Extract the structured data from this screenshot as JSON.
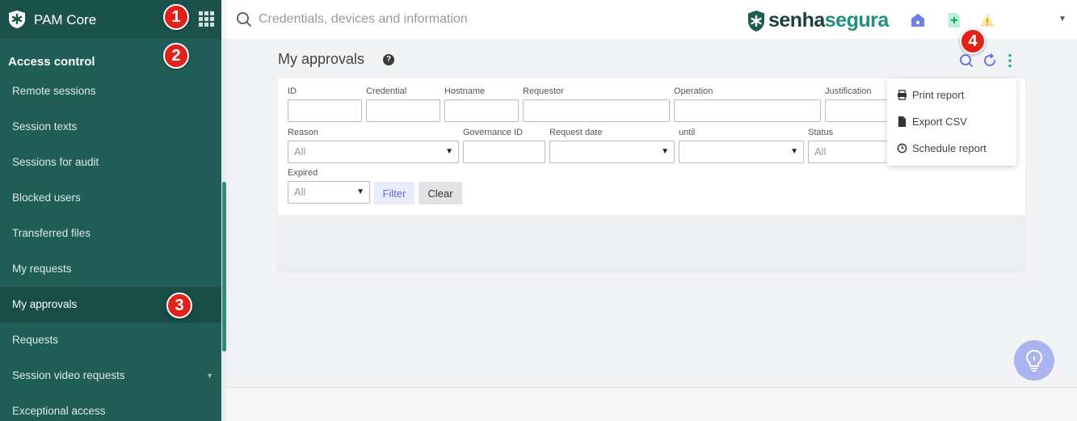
{
  "app": {
    "name": "PAM Core"
  },
  "topbar": {
    "search_placeholder": "Credentials, devices and information",
    "logo_part1": "senha",
    "logo_part2": "segura"
  },
  "sidebar": {
    "section_title": "Access control",
    "items": [
      {
        "label": "Remote sessions"
      },
      {
        "label": "Session texts"
      },
      {
        "label": "Sessions for audit"
      },
      {
        "label": "Blocked users"
      },
      {
        "label": "Transferred files"
      },
      {
        "label": "My requests"
      },
      {
        "label": "My approvals",
        "active": true
      },
      {
        "label": "Requests"
      },
      {
        "label": "Session video requests"
      },
      {
        "label": "Exceptional access"
      }
    ]
  },
  "main": {
    "title": "My approvals",
    "filters": {
      "id_label": "ID",
      "credential_label": "Credential",
      "hostname_label": "Hostname",
      "requestor_label": "Requestor",
      "operation_label": "Operation",
      "justification_label": "Justification",
      "reason_label": "Reason",
      "reason_value": "All",
      "governance_label": "Governance ID",
      "request_date_label": "Request date",
      "until_label": "until",
      "status_label": "Status",
      "status_value": "All",
      "expired_label": "Expired",
      "expired_value": "All",
      "filter_button": "Filter",
      "clear_button": "Clear"
    },
    "menu": {
      "print": "Print report",
      "export": "Export CSV",
      "schedule": "Schedule report"
    }
  },
  "markers": [
    "1",
    "2",
    "3",
    "4"
  ],
  "colors": {
    "sidebar": "#1f5d56",
    "accent": "#1f8f7d",
    "marker": "#e3211b"
  }
}
